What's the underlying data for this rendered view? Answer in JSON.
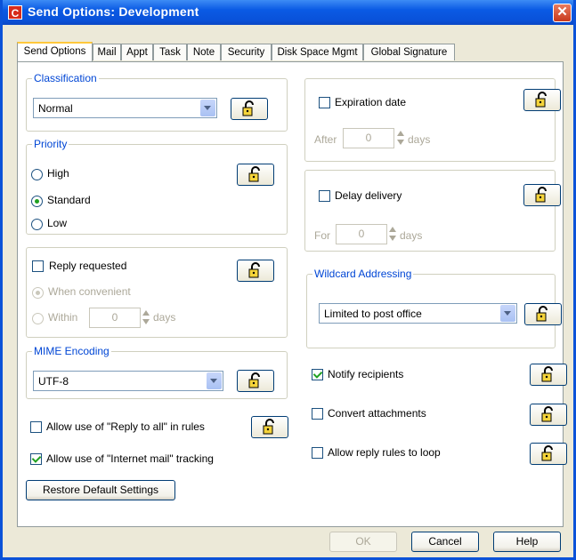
{
  "window": {
    "title": "Send Options:  Development",
    "app_icon": "C"
  },
  "tabs": [
    {
      "label": "Send Options"
    },
    {
      "label": "Mail"
    },
    {
      "label": "Appt"
    },
    {
      "label": "Task"
    },
    {
      "label": "Note"
    },
    {
      "label": "Security"
    },
    {
      "label": "Disk Space Mgmt"
    },
    {
      "label": "Global Signature"
    }
  ],
  "classification": {
    "legend": "Classification",
    "value": "Normal"
  },
  "priority": {
    "legend": "Priority",
    "options": [
      "High",
      "Standard",
      "Low"
    ],
    "selected": "Standard"
  },
  "reply": {
    "label": "Reply requested",
    "checked": false,
    "when_convenient": "When convenient",
    "within": "Within",
    "days_value": "0",
    "days_unit": "days"
  },
  "mime": {
    "legend": "MIME Encoding",
    "value": "UTF-8"
  },
  "allow_reply_all": {
    "label": "Allow use of  \"Reply to all\" in rules",
    "checked": false
  },
  "allow_internet_tracking": {
    "label": "Allow use of  \"Internet mail\" tracking",
    "checked": true
  },
  "restore_button": "Restore Default Settings",
  "expiration": {
    "label": "Expiration date",
    "checked": false,
    "prefix": "After",
    "value": "0",
    "unit": "days"
  },
  "delay": {
    "label": "Delay delivery",
    "checked": false,
    "prefix": "For",
    "value": "0",
    "unit": "days"
  },
  "wildcard": {
    "legend": "Wildcard Addressing",
    "value": "Limited to post office"
  },
  "notify": {
    "label": "Notify recipients",
    "checked": true
  },
  "convert": {
    "label": "Convert attachments",
    "checked": false
  },
  "loop": {
    "label": "Allow reply rules to loop",
    "checked": false
  },
  "buttons": {
    "ok": "OK",
    "cancel": "Cancel",
    "help": "Help"
  },
  "colors": {
    "title_bar": "#0a5ae4",
    "legend_text": "#0046d5",
    "dialog_bg": "#ece9d8"
  }
}
